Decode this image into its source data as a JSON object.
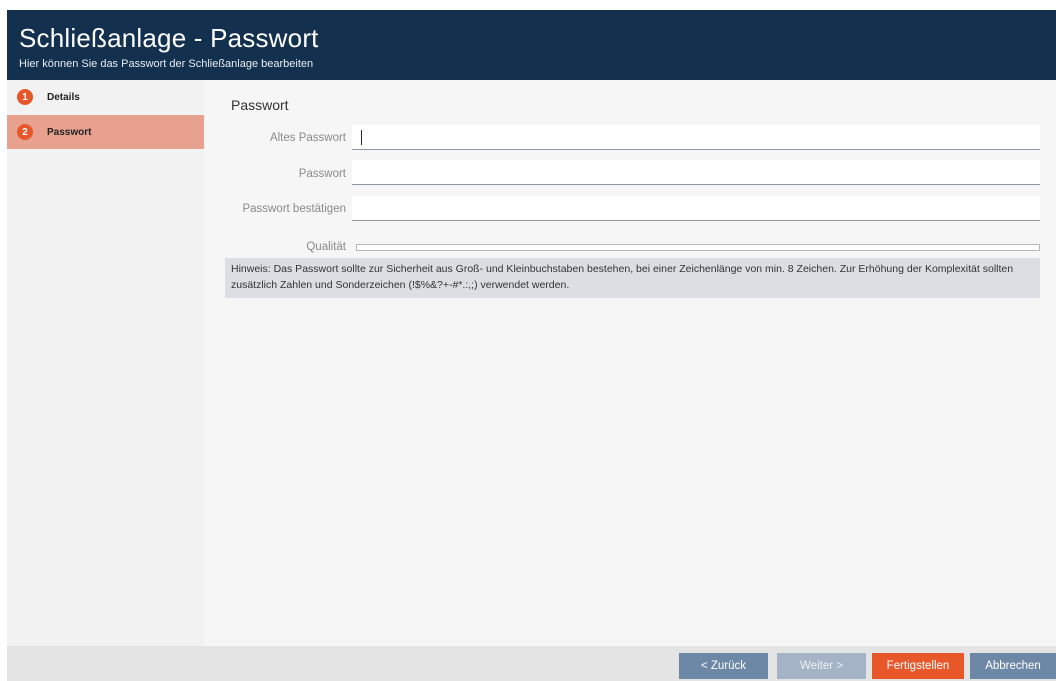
{
  "header": {
    "title": "Schließanlage - Passwort",
    "subtitle": "Hier können Sie das Passwort der Schließanlage bearbeiten"
  },
  "sidebar": {
    "steps": [
      {
        "number": "1",
        "label": "Details",
        "active": false
      },
      {
        "number": "2",
        "label": "Passwort",
        "active": true
      }
    ]
  },
  "main": {
    "section_title": "Passwort",
    "fields": [
      {
        "label": "Altes Passwort",
        "value": ""
      },
      {
        "label": "Passwort",
        "value": ""
      },
      {
        "label": "Passwort bestätigen",
        "value": ""
      }
    ],
    "quality_label": "Qualität",
    "quality_level": 0,
    "hint": "Hinweis: Das Passwort sollte zur Sicherheit aus Groß- und Kleinbuchstaben bestehen, bei einer Zeichenlänge von min. 8 Zeichen. Zur Erhöhung der Komplexität sollten zusätzlich Zahlen und Sonderzeichen (!$%&?+-#*.:,;) verwendet werden."
  },
  "footer": {
    "back_label": "< Zurück",
    "next_label": "Weiter >",
    "finish_label": "Fertigstellen",
    "cancel_label": "Abbrechen"
  },
  "colors": {
    "header_bg": "#13304f",
    "accent": "#e8572a",
    "active_step_bg": "#e8a18f",
    "button_blue": "#6d87a6"
  }
}
